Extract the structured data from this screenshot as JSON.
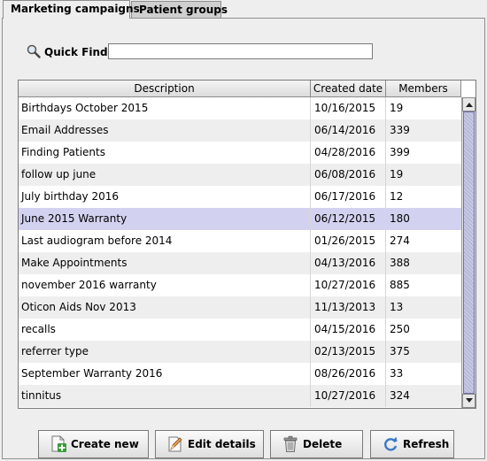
{
  "tabs": [
    {
      "label": "Marketing campaigns",
      "active": true
    },
    {
      "label": "Patient groups",
      "active": false
    }
  ],
  "quick_find": {
    "label": "Quick Find:",
    "value": "",
    "placeholder": ""
  },
  "table": {
    "columns": [
      "Description",
      "Created date",
      "Members"
    ],
    "rows": [
      {
        "description": "Birthdays October 2015",
        "created": "10/16/2015",
        "members": "19"
      },
      {
        "description": "Email Addresses",
        "created": "06/14/2016",
        "members": "339"
      },
      {
        "description": "Finding Patients",
        "created": "04/28/2016",
        "members": "399"
      },
      {
        "description": "follow up june",
        "created": "06/08/2016",
        "members": "19"
      },
      {
        "description": "July birthday 2016",
        "created": "06/17/2016",
        "members": "12"
      },
      {
        "description": "June 2015 Warranty",
        "created": "06/12/2015",
        "members": "180",
        "selected": true
      },
      {
        "description": "Last audiogram before 2014",
        "created": "01/26/2015",
        "members": "274"
      },
      {
        "description": "Make Appointments",
        "created": "04/13/2016",
        "members": "388"
      },
      {
        "description": "november 2016 warranty",
        "created": "10/27/2016",
        "members": "885"
      },
      {
        "description": "Oticon Aids Nov 2013",
        "created": "11/13/2013",
        "members": "13"
      },
      {
        "description": "recalls",
        "created": "04/15/2016",
        "members": "250"
      },
      {
        "description": "referrer type",
        "created": "02/13/2015",
        "members": "375"
      },
      {
        "description": "September Warranty 2016",
        "created": "08/26/2016",
        "members": "33"
      },
      {
        "description": "tinnitus",
        "created": "10/27/2016",
        "members": "324"
      }
    ]
  },
  "buttons": {
    "create": "Create new",
    "edit": "Edit details",
    "delete": "Delete",
    "refresh": "Refresh"
  },
  "icons": {
    "quick_find": "magnifier-icon",
    "create": "add-document-icon",
    "edit": "edit-pencil-icon",
    "delete": "trash-icon",
    "refresh": "refresh-arrows-icon"
  },
  "colors": {
    "selected_row": "#d2d2f0",
    "alt_row": "#eeeeee",
    "scroll_thumb": "#b8b8dc"
  }
}
